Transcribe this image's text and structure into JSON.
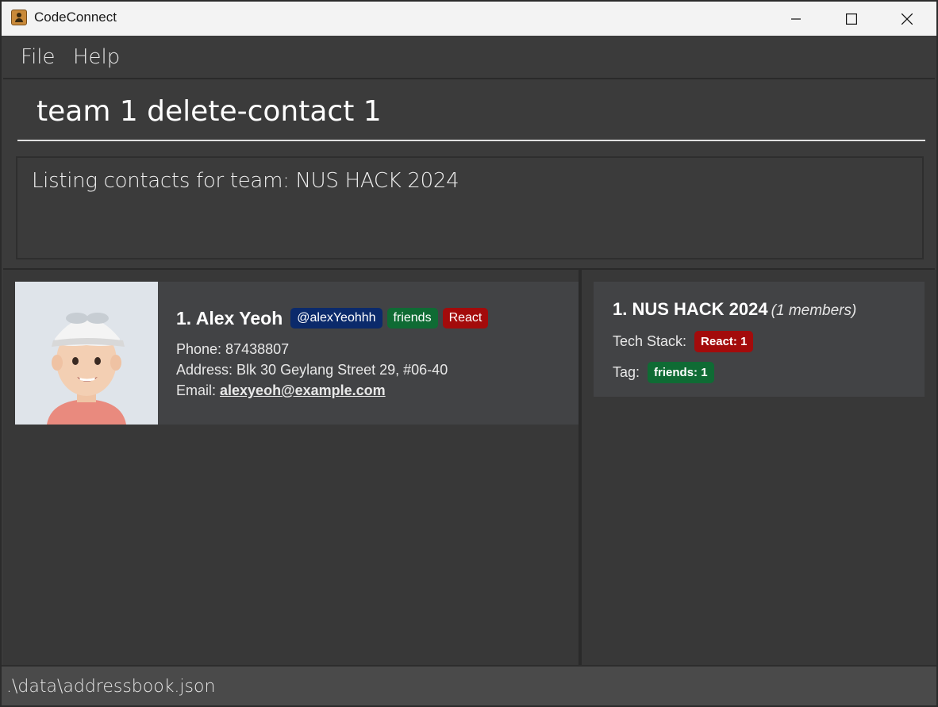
{
  "window": {
    "title": "CodeConnect"
  },
  "menu": {
    "file": "File",
    "help": "Help"
  },
  "command": {
    "value": "team 1 delete-contact 1"
  },
  "result": {
    "message": "Listing contacts for team: NUS HACK 2024"
  },
  "contacts": [
    {
      "index_name": "1.  Alex Yeoh",
      "tags": [
        {
          "label": "@alexYeohhh",
          "color": "#0b2a6b"
        },
        {
          "label": "friends",
          "color": "#0f6b34"
        },
        {
          "label": "React",
          "color": "#a30b0b"
        }
      ],
      "phone": "Phone: 87438807",
      "address": "Address: Blk 30 Geylang Street 29, #06-40",
      "email_label": "Email: ",
      "email": "alexyeoh@example.com"
    }
  ],
  "teams": [
    {
      "index_name": "1.  NUS HACK 2024",
      "members": "(1 members)",
      "tech_stack_label": "Tech Stack:",
      "tech_stack_chip": "React: 1",
      "tag_label": "Tag:",
      "tag_chip": "friends: 1"
    }
  ],
  "status": {
    "path": ".\\data\\addressbook.json"
  },
  "colors": {
    "accent_blue": "#0b2a6b",
    "accent_green": "#0f6b34",
    "accent_red": "#a30b0b"
  }
}
